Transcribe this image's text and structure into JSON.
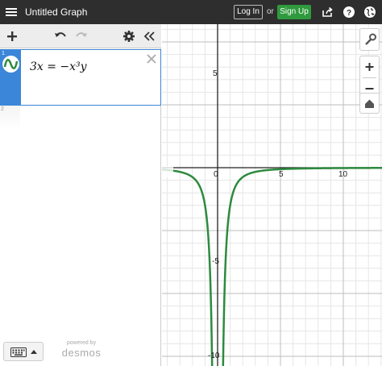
{
  "header": {
    "title": "Untitled Graph",
    "login_label": "Log In",
    "or_label": "or",
    "signup_label": "Sign Up",
    "icons": [
      "hamburger-menu-icon",
      "share-icon",
      "help-icon",
      "globe-icon"
    ]
  },
  "toolbar": {
    "icons": [
      "add-icon",
      "undo-icon",
      "redo-icon",
      "settings-icon",
      "collapse-icon"
    ]
  },
  "expressions": [
    {
      "index": "1",
      "latex_text": "3x = −x³y",
      "color": "#2d8a3e"
    },
    {
      "index": "2",
      "latex_text": ""
    }
  ],
  "footer": {
    "powered_by": "powered by",
    "brand": "desmos",
    "keyboard_icon": "keyboard-icon"
  },
  "graph": {
    "x_ticks": [
      "0",
      "5",
      "10"
    ],
    "y_ticks": [
      "5",
      "-5",
      "-10"
    ],
    "curve_color": "#2d8a3e",
    "zoom_icons": [
      "wrench-icon",
      "zoom-in-icon",
      "zoom-out-icon",
      "home-icon"
    ]
  },
  "colors": {
    "header_bg": "#2e2e2e",
    "signup_bg": "#2f9a3e",
    "accent": "#3b86d8"
  }
}
